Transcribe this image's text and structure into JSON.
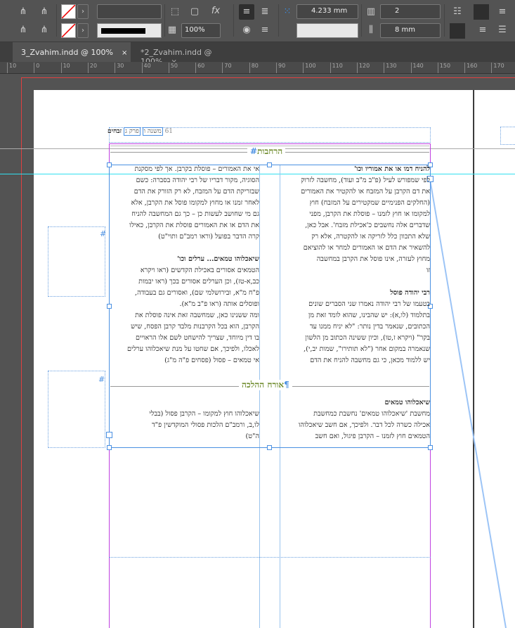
{
  "toolbar": {
    "stroke_weight": "",
    "opacity": "100%",
    "offset": "4.233 mm",
    "columns": "2",
    "gutter": "8 mm",
    "fx_label": "fx"
  },
  "tabs": [
    {
      "label": "3_Zvahim.indd @ 100%",
      "close": "×"
    },
    {
      "label": "*2_Zvahim.indd @ 100%",
      "close": "×"
    }
  ],
  "ruler": [
    "10",
    "0",
    "10",
    "20",
    "30",
    "40",
    "50",
    "60",
    "70",
    "80",
    "90",
    "100",
    "110",
    "120",
    "130",
    "140",
    "150",
    "160",
    "170"
  ],
  "header": {
    "title": "זבחים",
    "chapter": "פרק ג",
    "mishna": "משנה ו",
    "page": "61"
  },
  "section1": {
    "title": "הרחבות"
  },
  "right_col": {
    "h1": "להניח דמו או את אמוריו וכו'",
    "p1": [
      "לפי שמפורש לעיל (פ\"ב מ\"ב ועוד), מחשבה לזרוק",
      "את דם הקרבן על המזבח או להקטיר את האמורים",
      "(החלקים הפנימיים שמקטירים על המזבח) חוץ",
      "למקומו או חוץ לזמנו – פוסלת את הקרבן, מפני",
      "שדברים אלה נחשבים כ'אכילת מזבח'. אבל כאן,",
      "שלא התכוון כלל לזריקה או להקטרה, אלא רק",
      "להשאיר את הדם או האמורים למחר או להוציאם",
      "מחוץ לעזרה, אינו פוסל את הקרבן במחשבה",
      "זו"
    ],
    "h2": "רבי יהודה פוסל",
    "p2": [
      "בטעמו של רבי יהודה נאמרו שני הסברים שונים",
      "בתלמוד (לו,א): יש שהבינו, שהוא לומד זאת מן",
      "הכתובים, שנאמר בדין נותר: \"לא יניח ממנו עד",
      "בקר\" (ויקרא ז,טו), וכיון ששינה הכתוב מן הלשון",
      "שנאמרה במקום אחר (\"לא תותירו\", שמות יב,י),",
      "יש ללמוד מכאן, כי גם מחשבה להניח את הדם"
    ]
  },
  "left_col": {
    "p1": [
      "אי את האמורים – פוסלת בקרבן. אך לפי מסקנת",
      "הסוגיה, מקור דבריו של רבי יהודה בסברה: כשם",
      "שבזריקת הדם על המזבח, לא רק הזורק את הדם",
      "לאחר זמנו או מחוץ למקומו פוסל את הקרבן, אלא",
      "גם מי שחושב לעשות כן – כך גם המחשבה להניח",
      "את הדם או את האמורים פוסלת את הקרבן, כאילו",
      "קרה הדבר בפועל (וראו רמב\"ם ותוי\"ט)"
    ],
    "h2": "שיאכלוהו טמאים... ערלים וכו'",
    "p2": [
      "הטמאים אסורים באכילת הקדשים (ראו ויקרא",
      "כב,א-טז), וכן הערלים אסורים בכך (ראו יבמות",
      "פ\"ח מ\"א, ובירושלמי שם), ואסורים גם בעבודה,",
      "ופוסלים אותה (ראו פ\"ב מ\"א).",
      "ומה ששנינו כאן, שמחשבה זאת אינה פוסלת את",
      "הקרבן, הוא בכל הקרבנות מלבד קרבן הפסח, שיש",
      "בו דין מיוחד, שצריך להישחט לשם אלו הראויים",
      "לאכלו, ולפיכך, אם שחטו על מנת שיאכלוהו ערלים",
      "אי טמאים – פסול (פסחים פ\"ה מ\"ג)"
    ]
  },
  "section2": {
    "title": "אורח ההלכה"
  },
  "right_col2": {
    "h1": "שיאכלוהו טמאים",
    "p1": [
      "מחשבת 'שיאכלוהו טמאים' נחשבת כמחשבת",
      "אכילה כשרה לכל דבר. ולפיכך, אם חשב שיאכלוהו",
      "הטמאים חוץ לזמנו – הקרבן פיגול, ואם חשב"
    ]
  },
  "left_col2": {
    "p1": [
      "שיאכלוהו חוץ למקומו – הקרבן פסול (בבלי",
      "לו,ב, ורמב\"ם הלכות פסולי המוקדשין פ\"ד",
      "ה\"ט)"
    ]
  },
  "pilcrow": "¶"
}
